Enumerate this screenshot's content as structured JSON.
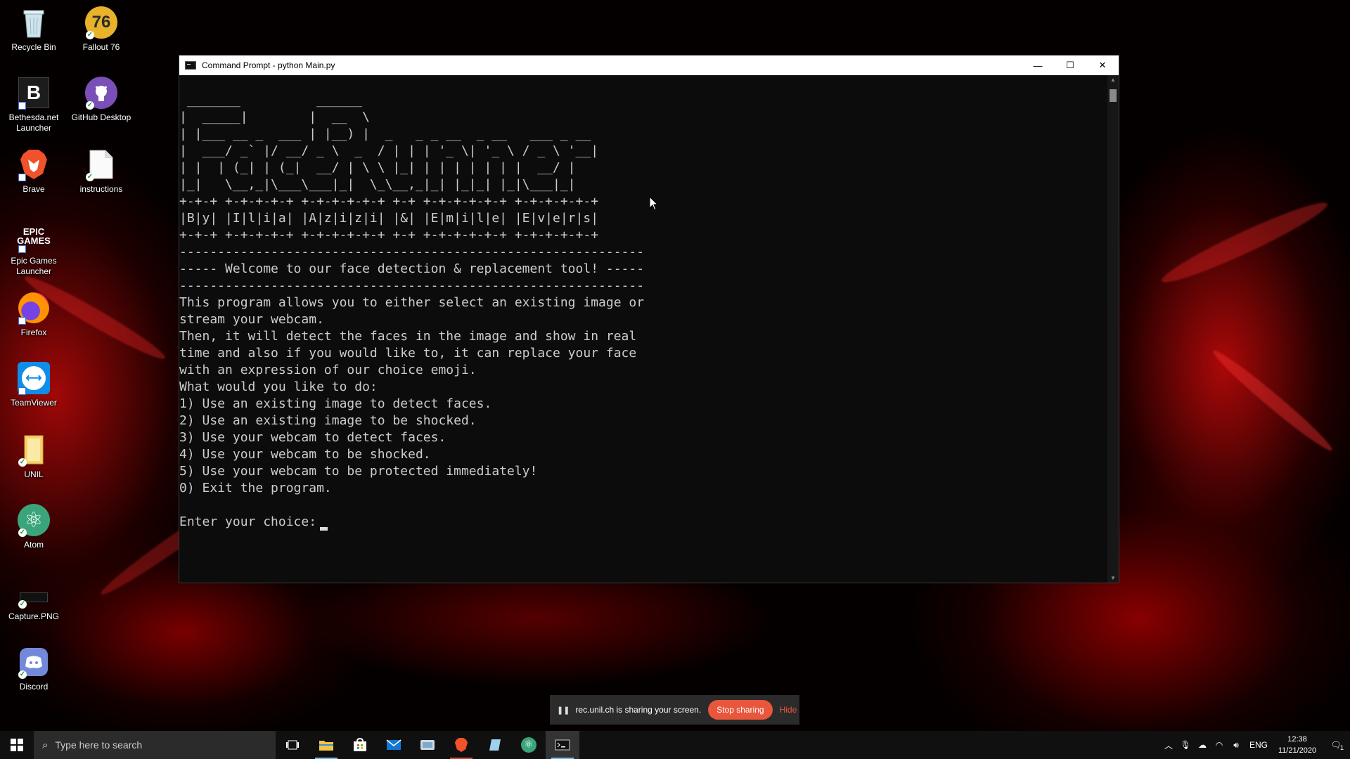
{
  "desktop_icons": [
    {
      "label": "Recycle Bin",
      "icon": "recycle-bin-icon"
    },
    {
      "label": "Fallout 76",
      "icon": "fallout-76-icon",
      "glyph": "76"
    },
    {
      "label": "Bethesda.net Launcher",
      "icon": "bethesda-launcher-icon",
      "glyph": "B"
    },
    {
      "label": "GitHub Desktop",
      "icon": "github-desktop-icon"
    },
    {
      "label": "Brave",
      "icon": "brave-icon"
    },
    {
      "label": "instructions",
      "icon": "text-file-icon"
    },
    {
      "label": "Epic Games Launcher",
      "icon": "epic-games-icon",
      "glyph": "EPIC\nGAMES"
    },
    {
      "label": "Firefox",
      "icon": "firefox-icon"
    },
    {
      "label": "TeamViewer",
      "icon": "teamviewer-icon"
    },
    {
      "label": "UNIL",
      "icon": "folder-icon"
    },
    {
      "label": "Atom",
      "icon": "atom-icon"
    },
    {
      "label": "Capture.PNG",
      "icon": "image-file-icon"
    },
    {
      "label": "Discord",
      "icon": "discord-icon"
    }
  ],
  "window": {
    "title": "Command Prompt - python  Main.py",
    "buttons": {
      "minimize": "—",
      "maximize": "☐",
      "close": "✕"
    }
  },
  "terminal": {
    "banner": " _______          ______\n|  _____|        |  __  \\\n| |___ __ _  ___ | |__) |  _   _ _ __  _ __   ___ _ __\n|  ___/ _` |/ __/ _ \\  _  / | | | '_ \\| '_ \\ / _ \\ '__|\n| |  | (_| | (_|  __/ | \\ \\ |_| | | | | | | |  __/ |\n|_|   \\__,_|\\___\\___|_|  \\_\\__,_|_| |_|_| |_|\\___|_|",
    "credits_border": "+-+-+ +-+-+-+-+ +-+-+-+-+-+ +-+ +-+-+-+-+-+ +-+-+-+-+-+",
    "credits": "|B|y| |I|l|i|a| |A|z|i|z|i| |&| |E|m|i|l|e| |E|v|e|r|s|",
    "rule": "-------------------------------------------------------------",
    "welcome": "----- Welcome to our face detection & replacement tool! -----",
    "description": "This program allows you to either select an existing image or\nstream your webcam.\nThen, it will detect the faces in the image and show in real\ntime and also if you would like to, it can replace your face\nwith an expression of our choice emoji.",
    "menu_prompt": "What would you like to do:",
    "options": [
      "1) Use an existing image to detect faces.",
      "2) Use an existing image to be shocked.",
      "3) Use your webcam to detect faces.",
      "4) Use your webcam to be shocked.",
      "5) Use your webcam to be protected immediately!",
      "0) Exit the program."
    ],
    "input_prompt": "Enter your choice:"
  },
  "share_bar": {
    "message": "rec.unil.ch is sharing your screen.",
    "stop_label": "Stop sharing",
    "hide_label": "Hide"
  },
  "taskbar": {
    "search_placeholder": "Type here to search",
    "language": "ENG",
    "time": "12:38",
    "date": "11/21/2020",
    "notification_count": "1"
  },
  "colors": {
    "accent": "#cf4b35",
    "share_button": "#e8563c",
    "terminal_text": "#cccccc",
    "terminal_bg": "#0c0c0c"
  }
}
